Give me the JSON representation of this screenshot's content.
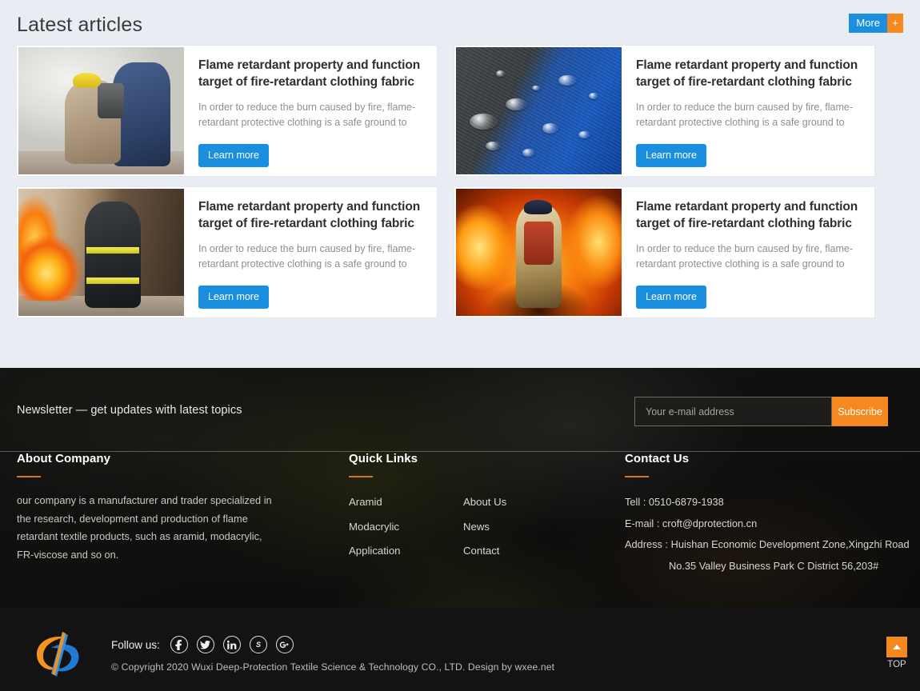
{
  "articles": {
    "heading": "Latest articles",
    "more_button": {
      "label": "More",
      "plus": "+"
    },
    "items": [
      {
        "title": "Flame retardant property and function target of fire-retardant clothing fabric",
        "excerpt": "In order to reduce the burn caused by fire, flame-retardant protective clothing is a safe ground to",
        "button": "Learn more",
        "image_alt": "firefighters-in-smoke"
      },
      {
        "title": "Flame retardant property and function target of fire-retardant clothing fabric",
        "excerpt": "In order to reduce the burn caused by fire, flame-retardant protective clothing is a safe ground to",
        "button": "Learn more",
        "image_alt": "water-droplets-on-blue-fabric"
      },
      {
        "title": "Flame retardant property and function target of fire-retardant clothing fabric",
        "excerpt": "In order to reduce the burn caused by fire, flame-retardant protective clothing is a safe ground to",
        "button": "Learn more",
        "image_alt": "firefighter-beside-flames"
      },
      {
        "title": "Flame retardant property and function target of fire-retardant clothing fabric",
        "excerpt": "In order to reduce the burn caused by fire, flame-retardant protective clothing is a safe ground to",
        "button": "Learn more",
        "image_alt": "firefighter-surrounded-by-fire"
      }
    ]
  },
  "newsletter": {
    "text": "Newsletter — get updates with latest topics",
    "placeholder": "Your e-mail address",
    "value": "",
    "button": "Subscribe"
  },
  "footer": {
    "about": {
      "heading": "About Company",
      "text": "our company is a manufacturer and trader specialized in the research, development and production of flame retardant textile products, such as aramid, modacrylic, FR-viscose and so on."
    },
    "quick_links": {
      "heading": "Quick Links",
      "col1": [
        "Aramid",
        "Modacrylic",
        "Application"
      ],
      "col2": [
        "About Us",
        "News",
        "Contact"
      ]
    },
    "contact": {
      "heading": "Contact Us",
      "tel": "Tell : 0510-6879-1938",
      "email": "E-mail : croft@dprotection.cn",
      "address_line1": "Address : Huishan Economic Development Zone,Xingzhi Road",
      "address_line2": "No.35 Valley Business Park C District 56,203#"
    }
  },
  "bottom": {
    "follow_label": "Follow us:",
    "social": [
      {
        "name": "facebook-icon",
        "glyph": "f"
      },
      {
        "name": "twitter-icon",
        "glyph": "✉"
      },
      {
        "name": "linkedin-icon",
        "glyph": "in"
      },
      {
        "name": "skype-icon",
        "glyph": "S"
      },
      {
        "name": "google-plus-icon",
        "glyph": "G"
      }
    ],
    "copyright": "© Copyright 2020  Wuxi Deep-Protection Textile Science & Technology CO., LTD.   Design by wxee.net",
    "top_label": "TOP"
  },
  "colors": {
    "accent_blue": "#1a8fe0",
    "accent_orange": "#f5881f",
    "page_bg": "#e9edf3",
    "footer_dark": "#131313",
    "heading_underline": "#d4762a"
  }
}
